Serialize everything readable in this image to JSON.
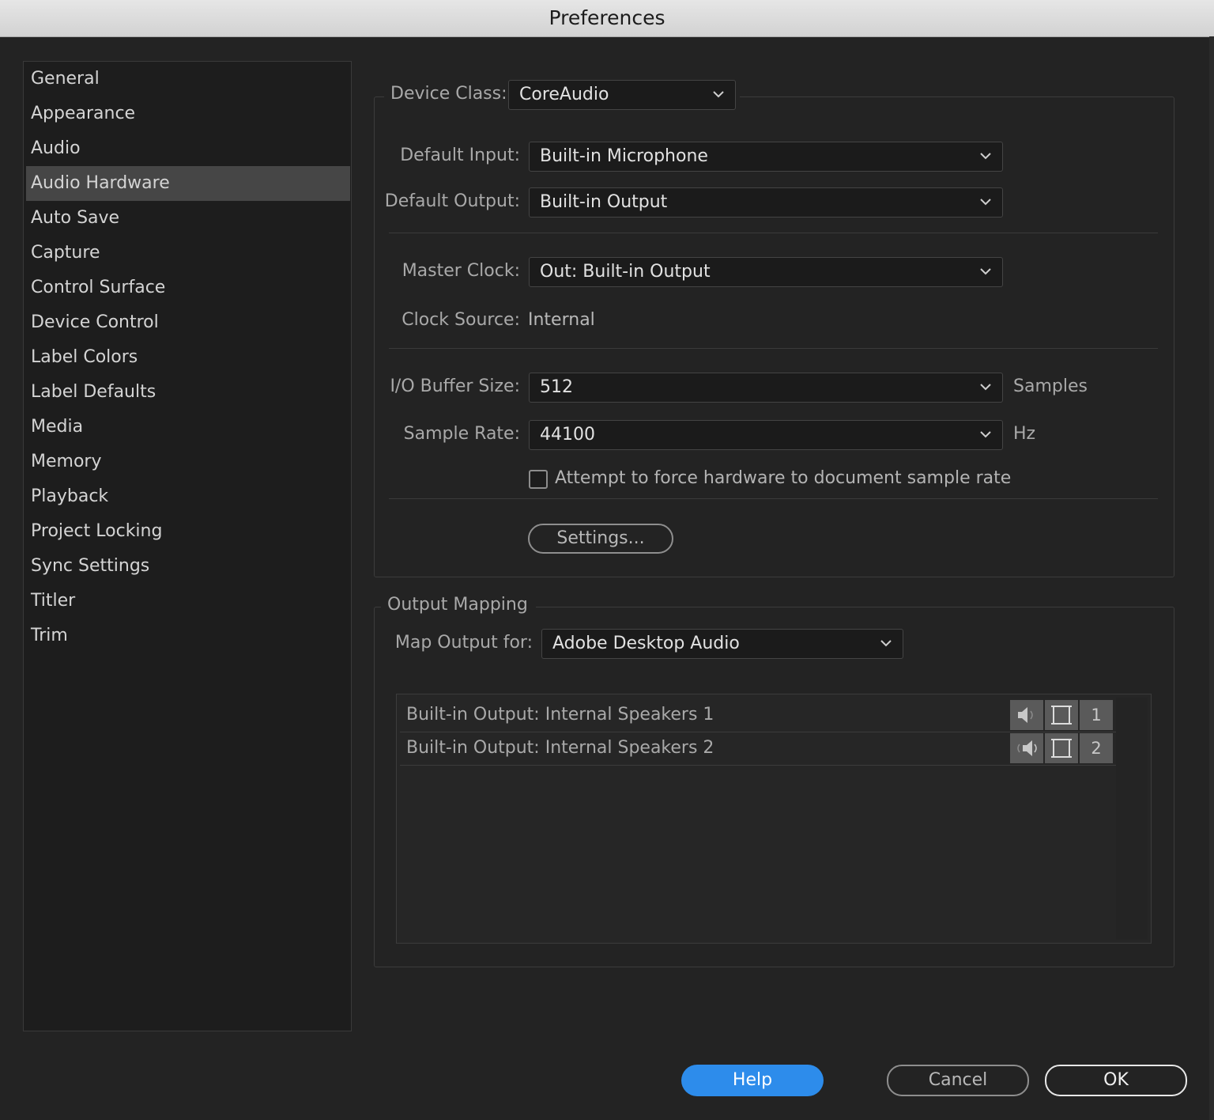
{
  "window": {
    "title": "Preferences"
  },
  "sidebar": {
    "items": [
      {
        "label": "General",
        "selected": false
      },
      {
        "label": "Appearance",
        "selected": false
      },
      {
        "label": "Audio",
        "selected": false
      },
      {
        "label": "Audio Hardware",
        "selected": true
      },
      {
        "label": "Auto Save",
        "selected": false
      },
      {
        "label": "Capture",
        "selected": false
      },
      {
        "label": "Control Surface",
        "selected": false
      },
      {
        "label": "Device Control",
        "selected": false
      },
      {
        "label": "Label Colors",
        "selected": false
      },
      {
        "label": "Label Defaults",
        "selected": false
      },
      {
        "label": "Media",
        "selected": false
      },
      {
        "label": "Memory",
        "selected": false
      },
      {
        "label": "Playback",
        "selected": false
      },
      {
        "label": "Project Locking",
        "selected": false
      },
      {
        "label": "Sync Settings",
        "selected": false
      },
      {
        "label": "Titler",
        "selected": false
      },
      {
        "label": "Trim",
        "selected": false
      }
    ]
  },
  "device": {
    "class_label": "Device Class:",
    "class_value": "CoreAudio",
    "default_input_label": "Default Input:",
    "default_input_value": "Built-in Microphone",
    "default_output_label": "Default Output:",
    "default_output_value": "Built-in Output",
    "master_clock_label": "Master Clock:",
    "master_clock_value": "Out: Built-in Output",
    "clock_source_label": "Clock Source:",
    "clock_source_value": "Internal",
    "buffer_label": "I/O Buffer Size:",
    "buffer_value": "512",
    "buffer_unit": "Samples",
    "sample_rate_label": "Sample Rate:",
    "sample_rate_value": "44100",
    "sample_rate_unit": "Hz",
    "force_rate_label": "Attempt to force hardware to document sample rate",
    "force_rate_checked": false,
    "settings_button": "Settings..."
  },
  "output_mapping": {
    "title": "Output Mapping",
    "map_for_label": "Map Output for:",
    "map_for_value": "Adobe Desktop Audio",
    "rows": [
      {
        "label": "Built-in Output: Internal Speakers 1",
        "channel": "1",
        "icon": "speaker-left-icon"
      },
      {
        "label": "Built-in Output: Internal Speakers 2",
        "channel": "2",
        "icon": "speaker-right-icon"
      }
    ]
  },
  "footer": {
    "help": "Help",
    "cancel": "Cancel",
    "ok": "OK"
  },
  "colors": {
    "accent": "#2d8ceb",
    "background": "#232323",
    "selected_item": "#464646"
  }
}
